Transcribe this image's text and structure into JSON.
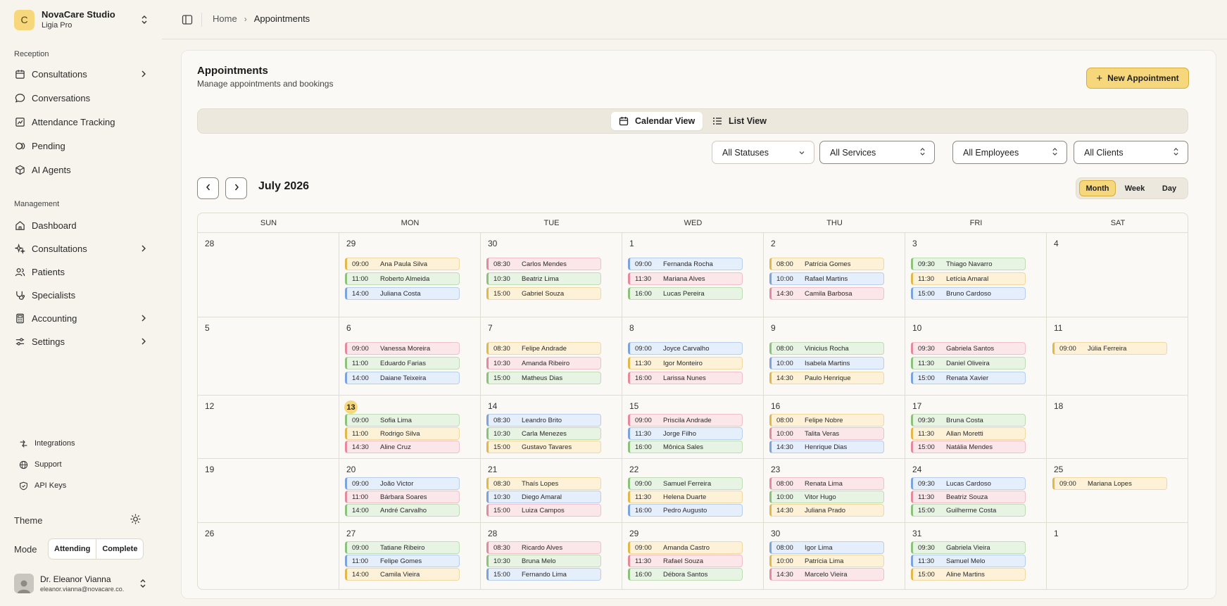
{
  "org": {
    "logo_letter": "C",
    "name": "NovaCare Studio",
    "plan": "Ligia Pro"
  },
  "sidebar": {
    "reception_title": "Reception",
    "reception_items": [
      {
        "label": "Consultations",
        "icon": "calendar-icon",
        "has_chevron": true
      },
      {
        "label": "Conversations",
        "icon": "chat-bubble-icon",
        "has_chevron": false
      },
      {
        "label": "Attendance Tracking",
        "icon": "chart-icon",
        "has_chevron": false
      },
      {
        "label": "Pending",
        "icon": "coins-icon",
        "has_chevron": false
      },
      {
        "label": "AI Agents",
        "icon": "cube-icon",
        "has_chevron": false
      }
    ],
    "management_title": "Management",
    "management_items": [
      {
        "label": "Dashboard",
        "icon": "home-icon",
        "has_chevron": false
      },
      {
        "label": "Consultations",
        "icon": "sparkles-icon",
        "has_chevron": true
      },
      {
        "label": "Patients",
        "icon": "users-icon",
        "has_chevron": false
      },
      {
        "label": "Specialists",
        "icon": "stethoscope-icon",
        "has_chevron": false
      },
      {
        "label": "Accounting",
        "icon": "calculator-icon",
        "has_chevron": true
      },
      {
        "label": "Settings",
        "icon": "sliders-icon",
        "has_chevron": true
      }
    ],
    "utility_items": [
      {
        "label": "Integrations",
        "icon": "integrations-icon"
      },
      {
        "label": "Support",
        "icon": "globe-icon"
      },
      {
        "label": "API Keys",
        "icon": "key-shield-icon"
      }
    ],
    "theme_label": "Theme",
    "mode_label": "Mode",
    "mode_options": [
      "Attending",
      "Complete"
    ],
    "user": {
      "name": "Dr. Eleanor Vianna",
      "email": "eleanor.vianna@novacare.co."
    }
  },
  "breadcrumb": {
    "home": "Home",
    "current": "Appointments"
  },
  "page": {
    "title": "Appointments",
    "subtitle": "Manage appointments and bookings",
    "new_button": "New Appointment"
  },
  "views": {
    "calendar": "Calendar View",
    "list": "List View",
    "active": "calendar"
  },
  "filters": [
    "All Statuses",
    "All Services",
    "All Employees",
    "All Clients"
  ],
  "calendar": {
    "month_label": "July 2026",
    "ranges": [
      "Month",
      "Week",
      "Day"
    ],
    "active_range": "Month",
    "weekdays": [
      "SUN",
      "MON",
      "TUE",
      "WED",
      "THU",
      "FRI",
      "SAT"
    ],
    "today": 13,
    "colors": {
      "yellow": "#f6d77c",
      "green": "#8cc27c",
      "blue": "#7da3dd",
      "pink": "#e58a9c"
    },
    "weeks": [
      [
        {
          "day": "28",
          "events": []
        },
        {
          "day": "29",
          "events": [
            {
              "time": "09:00",
              "name": "Ana Paula Silva",
              "color": "yellow"
            },
            {
              "time": "11:00",
              "name": "Roberto Almeida",
              "color": "green"
            },
            {
              "time": "14:00",
              "name": "Juliana Costa",
              "color": "blue"
            }
          ]
        },
        {
          "day": "30",
          "events": [
            {
              "time": "08:30",
              "name": "Carlos Mendes",
              "color": "pink"
            },
            {
              "time": "10:30",
              "name": "Beatriz Lima",
              "color": "green"
            },
            {
              "time": "15:00",
              "name": "Gabriel Souza",
              "color": "yellow"
            }
          ]
        },
        {
          "day": "1",
          "events": [
            {
              "time": "09:00",
              "name": "Fernanda Rocha",
              "color": "blue"
            },
            {
              "time": "11:30",
              "name": "Mariana Alves",
              "color": "pink"
            },
            {
              "time": "16:00",
              "name": "Lucas Pereira",
              "color": "green"
            }
          ]
        },
        {
          "day": "2",
          "events": [
            {
              "time": "08:00",
              "name": "Patrícia Gomes",
              "color": "yellow"
            },
            {
              "time": "10:00",
              "name": "Rafael Martins",
              "color": "blue"
            },
            {
              "time": "14:30",
              "name": "Camila Barbosa",
              "color": "pink"
            }
          ]
        },
        {
          "day": "3",
          "events": [
            {
              "time": "09:30",
              "name": "Thiago Navarro",
              "color": "green"
            },
            {
              "time": "11:30",
              "name": "Letícia Amaral",
              "color": "yellow"
            },
            {
              "time": "15:00",
              "name": "Bruno Cardoso",
              "color": "blue"
            }
          ]
        },
        {
          "day": "4",
          "events": []
        }
      ],
      [
        {
          "day": "5",
          "events": []
        },
        {
          "day": "6",
          "events": [
            {
              "time": "09:00",
              "name": "Vanessa Moreira",
              "color": "pink"
            },
            {
              "time": "11:00",
              "name": "Eduardo Farias",
              "color": "green"
            },
            {
              "time": "14:00",
              "name": "Daiane Teixeira",
              "color": "blue"
            }
          ]
        },
        {
          "day": "7",
          "events": [
            {
              "time": "08:30",
              "name": "Felipe Andrade",
              "color": "yellow"
            },
            {
              "time": "10:30",
              "name": "Amanda Ribeiro",
              "color": "pink"
            },
            {
              "time": "15:00",
              "name": "Matheus Dias",
              "color": "green"
            }
          ]
        },
        {
          "day": "8",
          "events": [
            {
              "time": "09:00",
              "name": "Joyce Carvalho",
              "color": "blue"
            },
            {
              "time": "11:30",
              "name": "Igor Monteiro",
              "color": "yellow"
            },
            {
              "time": "16:00",
              "name": "Larissa Nunes",
              "color": "pink"
            }
          ]
        },
        {
          "day": "9",
          "events": [
            {
              "time": "08:00",
              "name": "Vinicius Rocha",
              "color": "green"
            },
            {
              "time": "10:00",
              "name": "Isabela Martins",
              "color": "blue"
            },
            {
              "time": "14:30",
              "name": "Paulo Henrique",
              "color": "yellow"
            }
          ]
        },
        {
          "day": "10",
          "events": [
            {
              "time": "09:30",
              "name": "Gabriela Santos",
              "color": "pink"
            },
            {
              "time": "11:30",
              "name": "Daniel Oliveira",
              "color": "green"
            },
            {
              "time": "15:00",
              "name": "Renata Xavier",
              "color": "blue"
            }
          ]
        },
        {
          "day": "11",
          "events": [
            {
              "time": "09:00",
              "name": "Júlia Ferreira",
              "color": "yellow"
            }
          ]
        }
      ],
      [
        {
          "day": "12",
          "events": []
        },
        {
          "day": "13",
          "events": [
            {
              "time": "09:00",
              "name": "Sofia Lima",
              "color": "green"
            },
            {
              "time": "11:00",
              "name": "Rodrigo Silva",
              "color": "yellow"
            },
            {
              "time": "14:30",
              "name": "Aline Cruz",
              "color": "pink"
            }
          ]
        },
        {
          "day": "14",
          "events": [
            {
              "time": "08:30",
              "name": "Leandro Brito",
              "color": "blue"
            },
            {
              "time": "10:30",
              "name": "Carla Menezes",
              "color": "green"
            },
            {
              "time": "15:00",
              "name": "Gustavo Tavares",
              "color": "yellow"
            }
          ]
        },
        {
          "day": "15",
          "events": [
            {
              "time": "09:00",
              "name": "Priscila Andrade",
              "color": "pink"
            },
            {
              "time": "11:30",
              "name": "Jorge Filho",
              "color": "blue"
            },
            {
              "time": "16:00",
              "name": "Mônica Sales",
              "color": "green"
            }
          ]
        },
        {
          "day": "16",
          "events": [
            {
              "time": "08:00",
              "name": "Felipe Nobre",
              "color": "yellow"
            },
            {
              "time": "10:00",
              "name": "Talita Veras",
              "color": "pink"
            },
            {
              "time": "14:30",
              "name": "Henrique Dias",
              "color": "blue"
            }
          ]
        },
        {
          "day": "17",
          "events": [
            {
              "time": "09:30",
              "name": "Bruna Costa",
              "color": "green"
            },
            {
              "time": "11:30",
              "name": "Allan Moretti",
              "color": "yellow"
            },
            {
              "time": "15:00",
              "name": "Natália Mendes",
              "color": "pink"
            }
          ]
        },
        {
          "day": "18",
          "events": []
        }
      ],
      [
        {
          "day": "19",
          "events": []
        },
        {
          "day": "20",
          "events": [
            {
              "time": "09:00",
              "name": "João Victor",
              "color": "blue"
            },
            {
              "time": "11:00",
              "name": "Bárbara Soares",
              "color": "pink"
            },
            {
              "time": "14:00",
              "name": "André Carvalho",
              "color": "green"
            }
          ]
        },
        {
          "day": "21",
          "events": [
            {
              "time": "08:30",
              "name": "Thaís Lopes",
              "color": "yellow"
            },
            {
              "time": "10:30",
              "name": "Diego Amaral",
              "color": "blue"
            },
            {
              "time": "15:00",
              "name": "Luiza Campos",
              "color": "pink"
            }
          ]
        },
        {
          "day": "22",
          "events": [
            {
              "time": "09:00",
              "name": "Samuel Ferreira",
              "color": "green"
            },
            {
              "time": "11:30",
              "name": "Helena Duarte",
              "color": "yellow"
            },
            {
              "time": "16:00",
              "name": "Pedro Augusto",
              "color": "blue"
            }
          ]
        },
        {
          "day": "23",
          "events": [
            {
              "time": "08:00",
              "name": "Renata Lima",
              "color": "pink"
            },
            {
              "time": "10:00",
              "name": "Vitor Hugo",
              "color": "green"
            },
            {
              "time": "14:30",
              "name": "Juliana Prado",
              "color": "yellow"
            }
          ]
        },
        {
          "day": "24",
          "events": [
            {
              "time": "09:30",
              "name": "Lucas Cardoso",
              "color": "blue"
            },
            {
              "time": "11:30",
              "name": "Beatriz Souza",
              "color": "pink"
            },
            {
              "time": "15:00",
              "name": "Guilherme Costa",
              "color": "green"
            }
          ]
        },
        {
          "day": "25",
          "events": [
            {
              "time": "09:00",
              "name": "Mariana Lopes",
              "color": "yellow"
            }
          ]
        }
      ],
      [
        {
          "day": "26",
          "events": []
        },
        {
          "day": "27",
          "events": [
            {
              "time": "09:00",
              "name": "Tatiane Ribeiro",
              "color": "green"
            },
            {
              "time": "11:00",
              "name": "Felipe Gomes",
              "color": "blue"
            },
            {
              "time": "14:00",
              "name": "Camila Vieira",
              "color": "yellow"
            }
          ]
        },
        {
          "day": "28",
          "events": [
            {
              "time": "08:30",
              "name": "Ricardo Alves",
              "color": "pink"
            },
            {
              "time": "10:30",
              "name": "Bruna Melo",
              "color": "green"
            },
            {
              "time": "15:00",
              "name": "Fernando Lima",
              "color": "blue"
            }
          ]
        },
        {
          "day": "29",
          "events": [
            {
              "time": "09:00",
              "name": "Amanda Castro",
              "color": "yellow"
            },
            {
              "time": "11:30",
              "name": "Rafael Souza",
              "color": "pink"
            },
            {
              "time": "16:00",
              "name": "Débora Santos",
              "color": "green"
            }
          ]
        },
        {
          "day": "30",
          "events": [
            {
              "time": "08:00",
              "name": "Igor Lima",
              "color": "blue"
            },
            {
              "time": "10:00",
              "name": "Patrícia Lima",
              "color": "yellow"
            },
            {
              "time": "14:30",
              "name": "Marcelo Vieira",
              "color": "pink"
            }
          ]
        },
        {
          "day": "31",
          "events": [
            {
              "time": "09:30",
              "name": "Gabriela Vieira",
              "color": "green"
            },
            {
              "time": "11:30",
              "name": "Samuel Melo",
              "color": "blue"
            },
            {
              "time": "15:00",
              "name": "Aline Martins",
              "color": "yellow"
            }
          ]
        },
        {
          "day": "1",
          "events": []
        }
      ]
    ]
  }
}
